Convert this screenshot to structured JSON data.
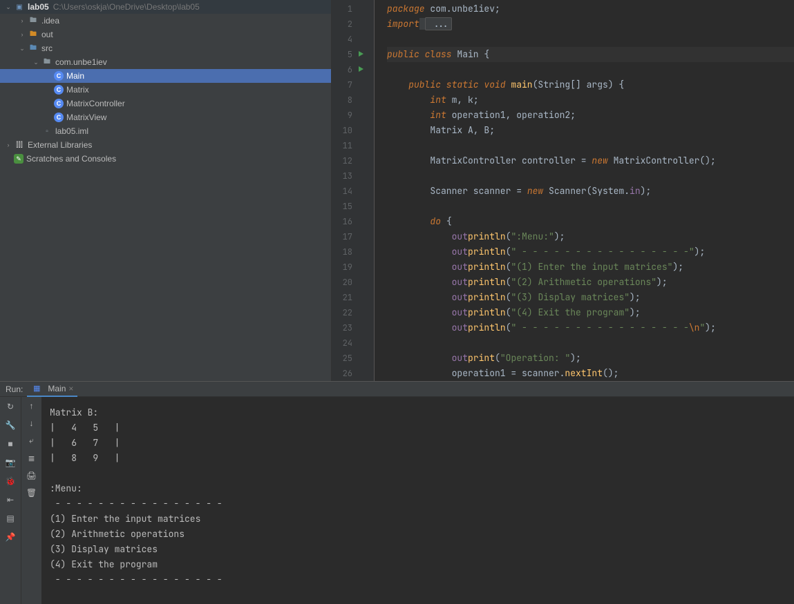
{
  "project": {
    "root": {
      "name": "lab05",
      "path": "C:\\Users\\oskja\\OneDrive\\Desktop\\lab05"
    },
    "idea": ".idea",
    "out": "out",
    "src": "src",
    "pkg": "com.unbe1iev",
    "classes": [
      "Main",
      "Matrix",
      "MatrixController",
      "MatrixView"
    ],
    "iml": "lab05.iml",
    "external": "External Libraries",
    "scratch": "Scratches and Consoles"
  },
  "editor": {
    "lines": [
      "1",
      "2",
      "4",
      "5",
      "6",
      "7",
      "8",
      "9",
      "10",
      "11",
      "12",
      "13",
      "14",
      "15",
      "16",
      "17",
      "18",
      "19",
      "20",
      "21",
      "22",
      "23",
      "24",
      "25",
      "26"
    ],
    "runMarkLines": [
      5,
      6
    ],
    "code": {
      "l1a": "package",
      "l1b": " com.unbe1iev;",
      "l2a": "import",
      "l2b": " ...",
      "l4": "",
      "l5a": "public class",
      "l5b": " Main ",
      "l5c": "{",
      "l6a": "    public static void",
      "l6b": " main",
      "l6c": "(String[] args) {",
      "l7a": "        int",
      "l7b": " m, k;",
      "l8a": "        int",
      "l8b": " operation1, operation2;",
      "l9a": "        Matrix A, B;",
      "l11a": "        MatrixController controller = ",
      "l11b": "new",
      "l11c": " MatrixController();",
      "l13a": "        Scanner scanner = ",
      "l13b": "new",
      "l13c": " Scanner(System.",
      "l13d": "in",
      "l13e": ");",
      "l15a": "        do",
      "l15b": " {",
      "l16a": "            out",
      ".": ".",
      "l16b": "println",
      "l16c": "(",
      "s16": "\":Menu:\"",
      "l16d": ");",
      "s17": "\" - - - - - - - - - - - - - - - -\"",
      "s18": "\"(1) Enter the input matrices\"",
      "s19": "\"(2) Arithmetic operations\"",
      "s20": "\"(3) Display matrices\"",
      "s21": "\"(4) Exit the program\"",
      "s22a": "\" - - - - - - - - - - - - - - - -",
      "s22esc": "\\n",
      "s22b": "\"",
      "l24b": "print",
      "s24": "\"Operation: \"",
      "l25": "            operation1 = scanner.",
      "l25b": "nextInt",
      "l25c": "();"
    }
  },
  "run": {
    "label": "Run:",
    "tab": "Main",
    "console": "Matrix B:\n|   4   5   |\n|   6   7   |\n|   8   9   |\n\n:Menu:\n - - - - - - - - - - - - - - - -\n(1) Enter the input matrices\n(2) Arithmetic operations\n(3) Display matrices\n(4) Exit the program\n - - - - - - - - - - - - - - - -"
  },
  "icons": {
    "rerun": "↻",
    "up": "↑",
    "down": "↓",
    "wrench": "🔧",
    "stop": "■",
    "wrap": "⤶",
    "cam": "📷",
    "print": "🖨",
    "bug": "🐞",
    "exit": "⇤",
    "layout": "▤",
    "trash": "🗑",
    "pin": "📌",
    "sep": "≣"
  }
}
